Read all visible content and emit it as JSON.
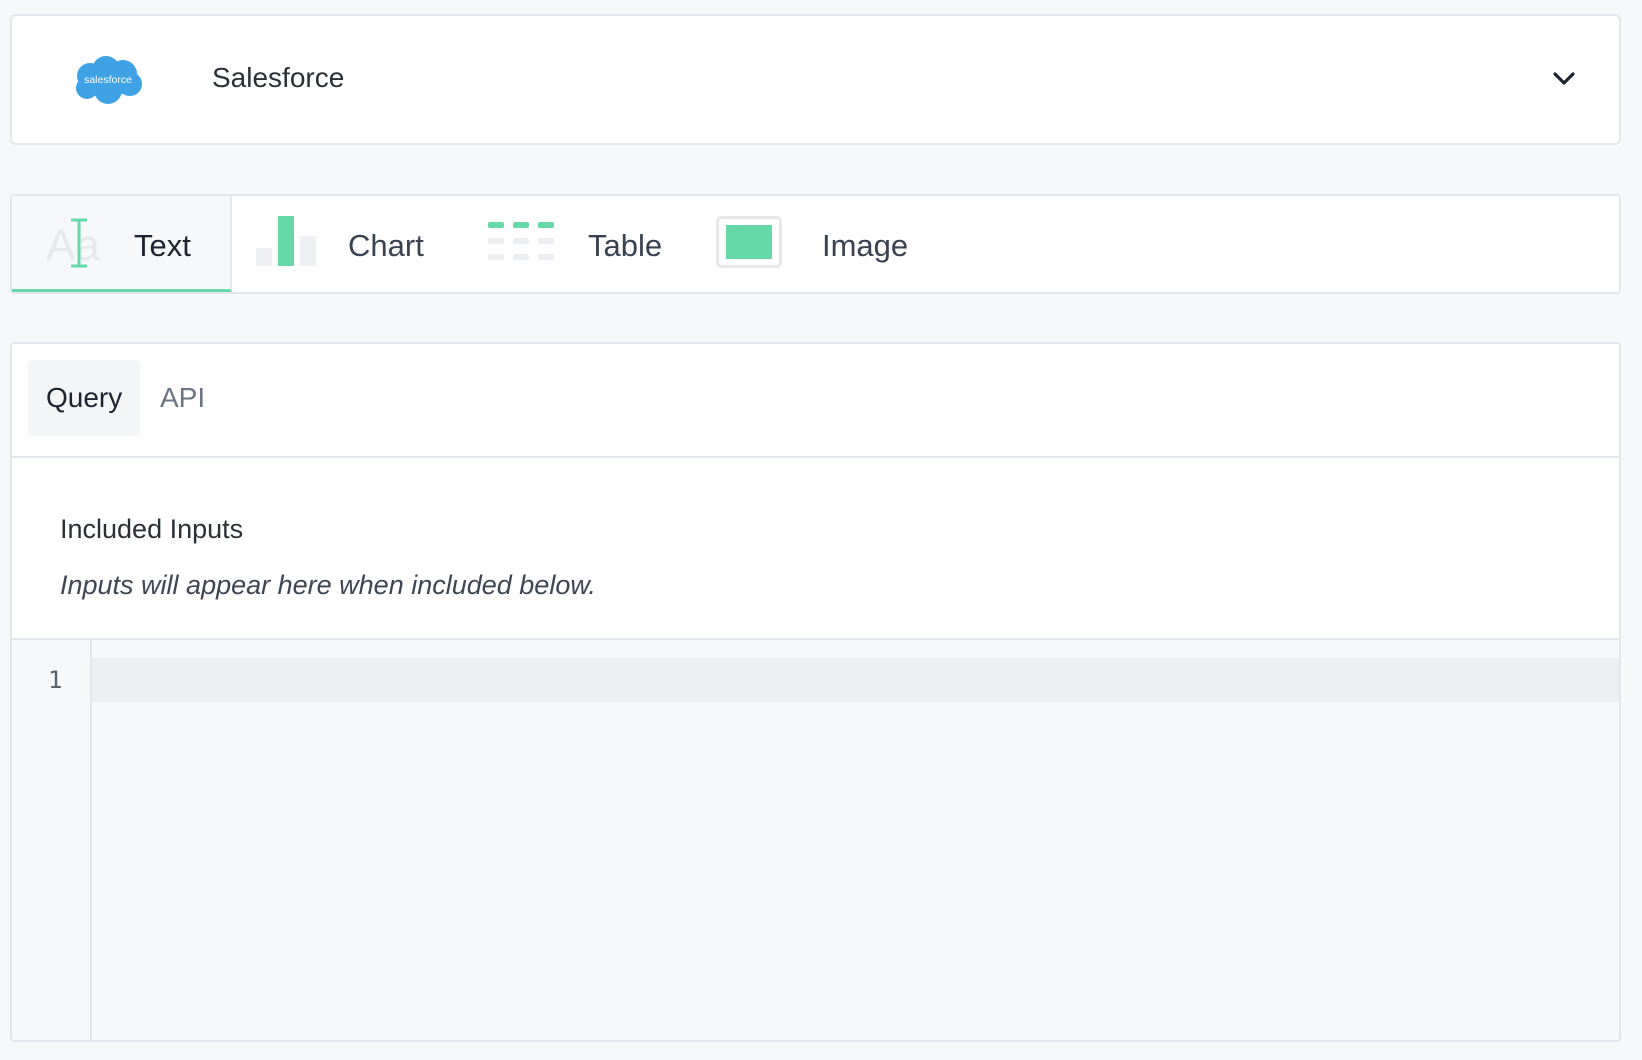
{
  "source": {
    "logo_text": "salesforce",
    "name": "Salesforce",
    "logo_color": "#3fa2e4"
  },
  "types": {
    "items": [
      {
        "label": "Text",
        "active": true
      },
      {
        "label": "Chart",
        "active": false
      },
      {
        "label": "Table",
        "active": false
      },
      {
        "label": "Image",
        "active": false
      }
    ],
    "accent_color": "#66d9a8",
    "text_icon_letters": "Aa"
  },
  "query": {
    "tabs": [
      {
        "label": "Query",
        "active": true
      },
      {
        "label": "API",
        "active": false
      }
    ],
    "included_inputs_title": "Included Inputs",
    "included_inputs_hint": "Inputs will appear here when included below.",
    "editor": {
      "line_numbers": [
        "1"
      ],
      "value": ""
    }
  }
}
